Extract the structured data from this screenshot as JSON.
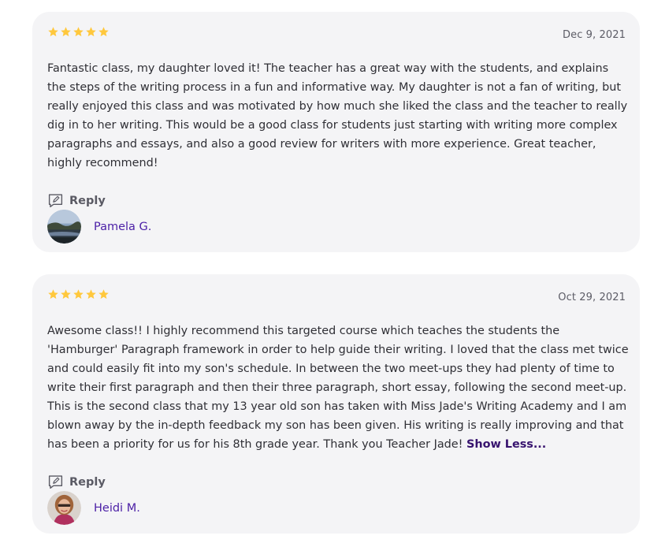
{
  "reviews": [
    {
      "rating": 5,
      "rating_max": 5,
      "date": "Dec 9, 2021",
      "text": "Fantastic class, my daughter loved it! The teacher has a great way with the students, and explains the steps of the writing process in a fun and informative way. My daughter is not a fan of writing, but really enjoyed this class and was motivated by how much she liked the class and the teacher to really dig in to her writing. This would be a good class for students just starting with writing more complex paragraphs and essays, and also a good review for writers with more experience. Great teacher, highly recommend!",
      "reply_label": "Reply",
      "author": "Pamela G.",
      "avatar_icon": "landscape-photo-avatar"
    },
    {
      "rating": 5,
      "rating_max": 5,
      "date": "Oct 29, 2021",
      "text": "Awesome class!! I highly recommend this targeted course which teaches the students the 'Hamburger' Paragraph framework in order to help guide their writing. I loved that the class met twice and could easily fit into my son's schedule. In between the two meet-ups they had plenty of time to write their first paragraph and then their three paragraph, short essay, following the second meet-up. This is the second class that my 13 year old son has taken with Miss Jade's Writing Academy and I am blown away by the in-depth feedback my son has been given. His writing is really improving and that has been a priority for us for his 8th grade year. Thank you Teacher Jade!",
      "show_less_label": "Show Less...",
      "reply_label": "Reply",
      "author": "Heidi M.",
      "avatar_icon": "person-photo-avatar"
    }
  ],
  "colors": {
    "star": "#ffc83d",
    "card_bg": "#f4f4f6",
    "author_link": "#4b1fa6",
    "show_less": "#37136e"
  }
}
